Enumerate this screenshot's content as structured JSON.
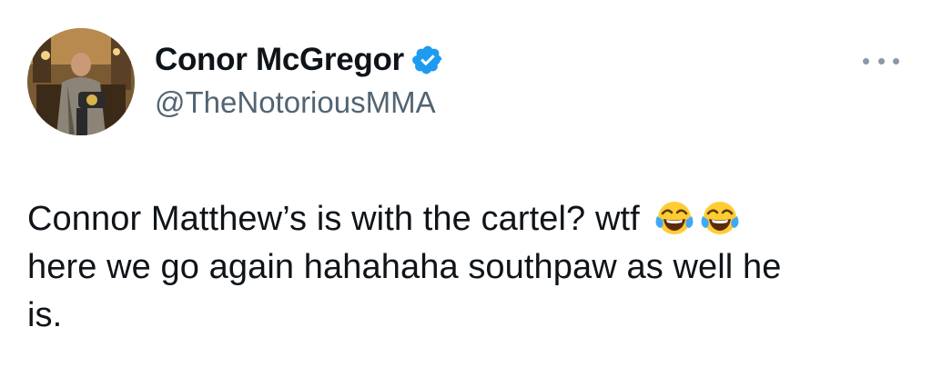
{
  "author": {
    "display_name": "Conor McGregor",
    "handle": "@TheNotoriousMMA",
    "verified": true,
    "verified_color": "#1d9bf0"
  },
  "tweet": {
    "text_line1": "Connor Matthew’s is with the cartel? wtf",
    "emoji_name": "face-with-tears-of-joy",
    "text_line2": "here we go again hahahaha southpaw as well he",
    "text_line3": "is."
  },
  "colors": {
    "text": "#0f1419",
    "handle": "#536471",
    "more_dots": "#8b98a5"
  },
  "icons": {
    "more": "ellipsis-icon",
    "verified": "verified-badge-icon"
  }
}
